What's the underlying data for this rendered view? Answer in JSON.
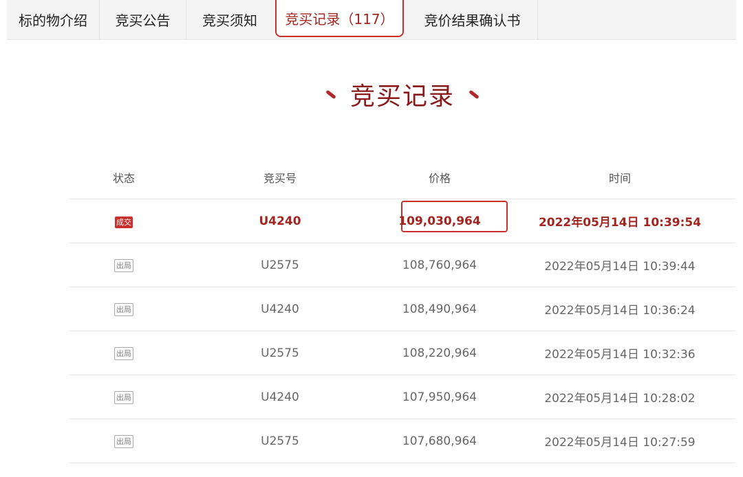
{
  "tabs": [
    {
      "label": "标的物介绍"
    },
    {
      "label": "竞买公告"
    },
    {
      "label": "竞买须知"
    },
    {
      "label": "竞买记录（117）",
      "active": true
    },
    {
      "label": "竞价结果确认书"
    }
  ],
  "section_title": "竞买记录",
  "table": {
    "headers": [
      "状态",
      "竞买号",
      "价格",
      "时间"
    ],
    "rows": [
      {
        "status": "成交",
        "bidder": "U4240",
        "price": "109,030,964",
        "time": "2022年05月14日 10:39:54"
      },
      {
        "status": "出局",
        "bidder": "U2575",
        "price": "108,760,964",
        "time": "2022年05月14日 10:39:44"
      },
      {
        "status": "出局",
        "bidder": "U4240",
        "price": "108,490,964",
        "time": "2022年05月14日 10:36:24"
      },
      {
        "status": "出局",
        "bidder": "U2575",
        "price": "108,220,964",
        "time": "2022年05月14日 10:32:36"
      },
      {
        "status": "出局",
        "bidder": "U4240",
        "price": "107,950,964",
        "time": "2022年05月14日 10:28:02"
      },
      {
        "status": "出局",
        "bidder": "U2575",
        "price": "107,680,964",
        "time": "2022年05月14日 10:27:59"
      }
    ]
  },
  "colors": {
    "accent": "#c9302c",
    "title": "#8b1a1a",
    "tab_bg": "#f4f4f4"
  }
}
